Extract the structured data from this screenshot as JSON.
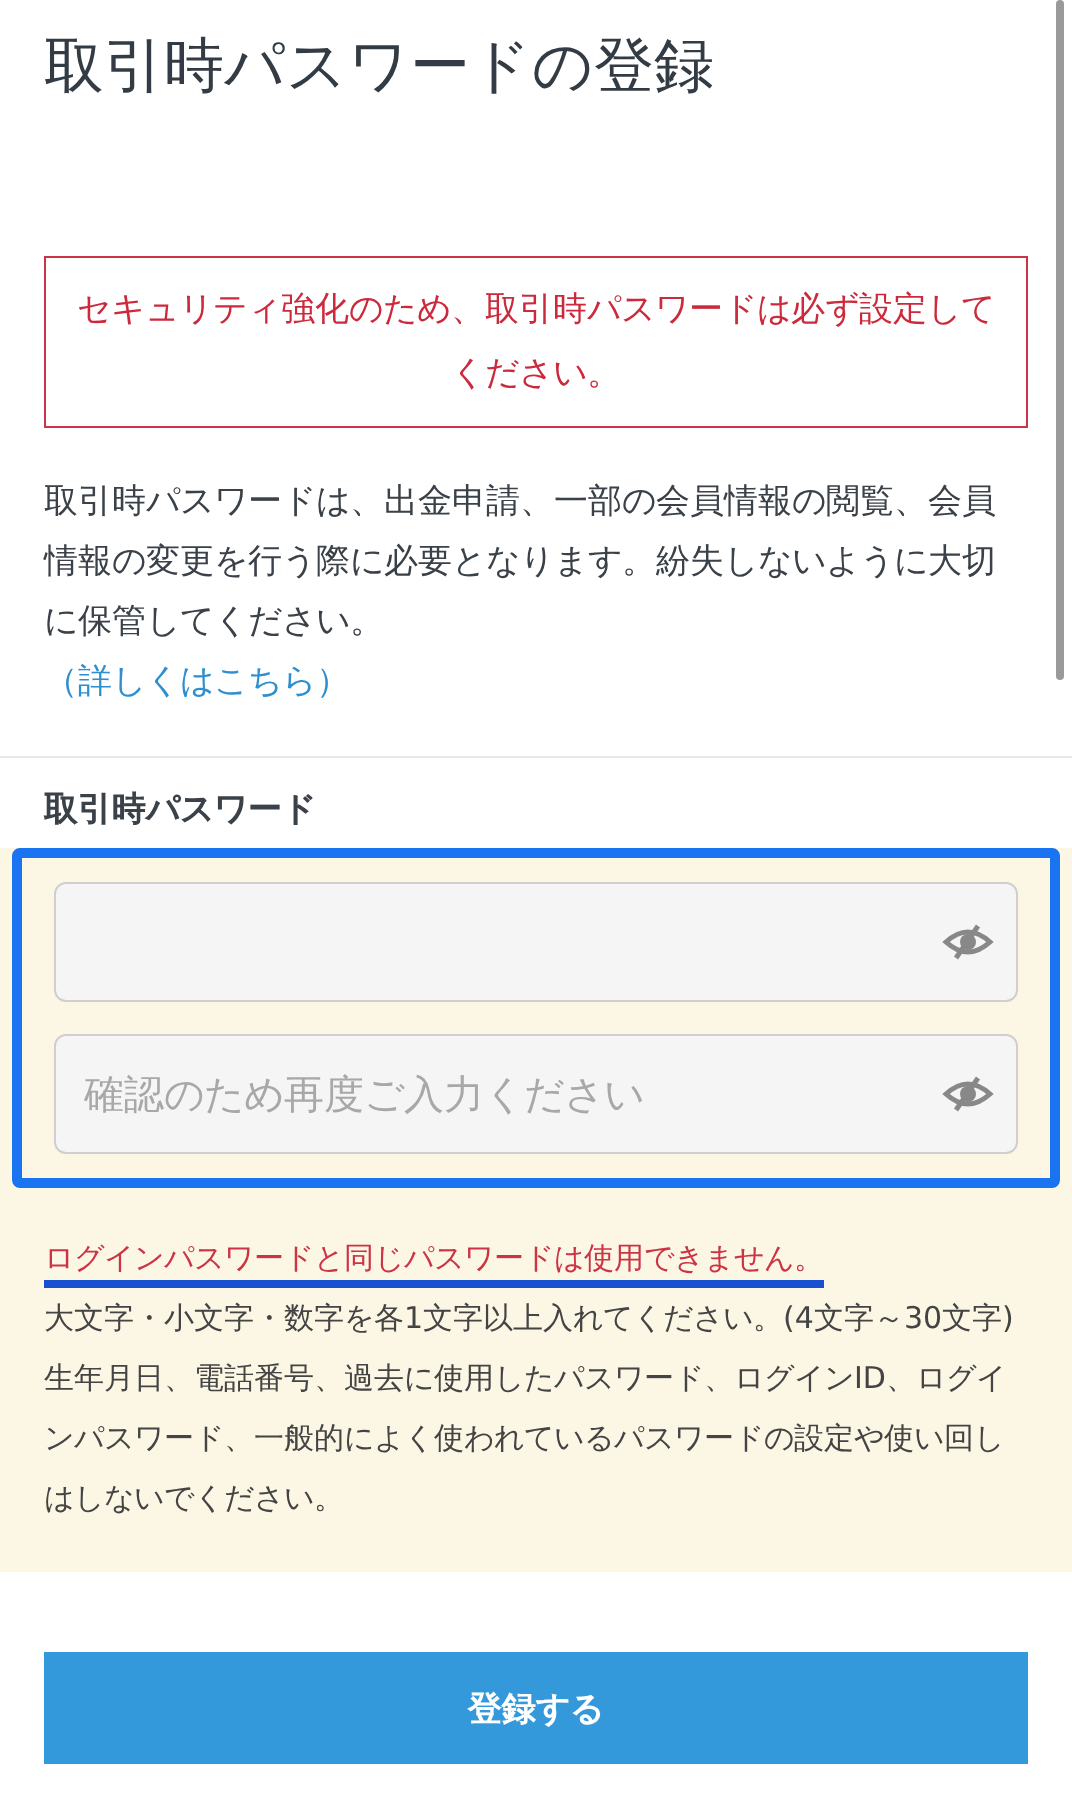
{
  "title": "取引時パスワードの登録",
  "alert": "セキュリティ強化のため、取引時パスワードは必ず設定してください。",
  "description": "取引時パスワードは、出金申請、一部の会員情報の閲覧、会員情報の変更を行う際に必要となります。紛失しないように大切に保管してください。",
  "details_link": "（詳しくはこちら）",
  "form": {
    "label": "取引時パスワード",
    "highlighted": true,
    "fields": [
      {
        "masked": true
      },
      {
        "masked": true,
        "placeholder": "確認のため再度ご入力ください"
      }
    ]
  },
  "notes": [
    {
      "kind": "error",
      "text": "ログインパスワードと同じパスワードは使用できません。",
      "underlined": true
    },
    {
      "kind": "hint",
      "text": "大文字・小文字・数字を各1文字以上入れてください。(4文字～30文字)",
      "underlined": false
    },
    {
      "kind": "hint",
      "text": "生年月日、電話番号、過去に使用したパスワード、ログインID、ログインパスワード、一般的によく使われているパスワードの設定や使い回しはしないでください。",
      "underlined": false
    }
  ],
  "submit": "登録する"
}
